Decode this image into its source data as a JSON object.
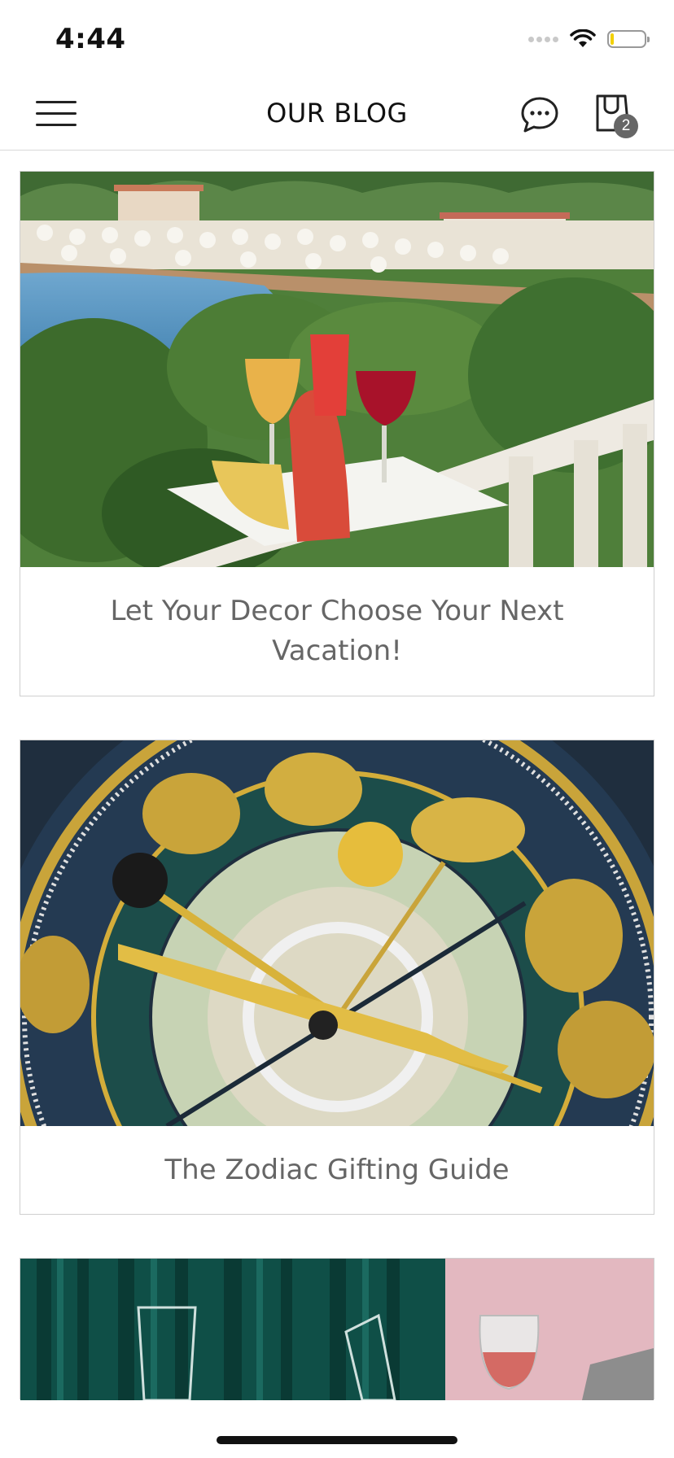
{
  "status_bar": {
    "time": "4:44"
  },
  "header": {
    "title": "OUR BLOG",
    "cart_count": "2"
  },
  "posts": [
    {
      "title": "Let Your Decor Choose Your Next Vacation!",
      "image": "beach-resort-drinks-photo"
    },
    {
      "title": "The Zodiac Gifting Guide",
      "image": "astronomical-clock-photo"
    },
    {
      "title": "",
      "image": "wine-glasses-curtain-photo"
    }
  ],
  "colors": {
    "caption_text": "#666666",
    "badge": "#666666",
    "border": "#cfcfcf"
  }
}
